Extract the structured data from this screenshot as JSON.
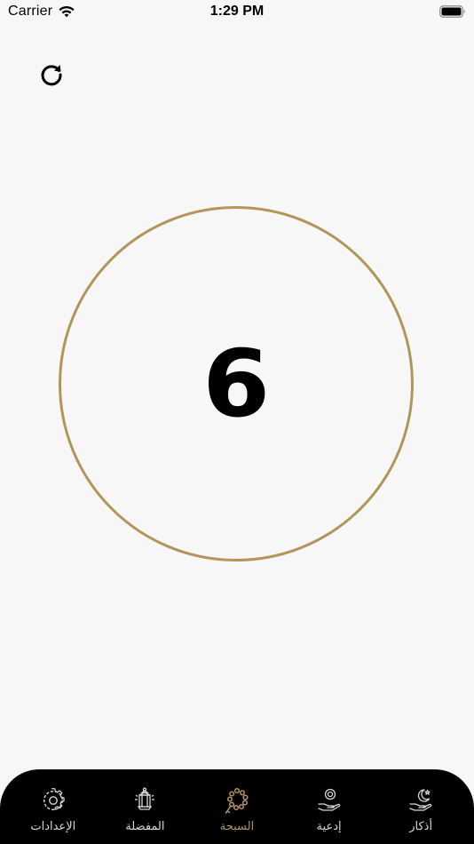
{
  "status_bar": {
    "carrier": "Carrier",
    "time": "1:29 PM"
  },
  "toolbar": {
    "reset_icon": "refresh-icon"
  },
  "counter": {
    "value": "6",
    "ring_color": "#b39559"
  },
  "tab_bar": {
    "active_color": "#b39559",
    "inactive_color": "#d7d7d7",
    "background": "#000000",
    "tabs": [
      {
        "label": "الإعدادات",
        "icon": "gear-icon",
        "active": false
      },
      {
        "label": "المفضلة",
        "icon": "lantern-icon",
        "active": false
      },
      {
        "label": "السبحة",
        "icon": "prayer-beads-icon",
        "active": true
      },
      {
        "label": "إدعية",
        "icon": "hand-prayer-icon",
        "active": false
      },
      {
        "label": "أذكار",
        "icon": "hand-moon-icon",
        "active": false
      }
    ]
  }
}
